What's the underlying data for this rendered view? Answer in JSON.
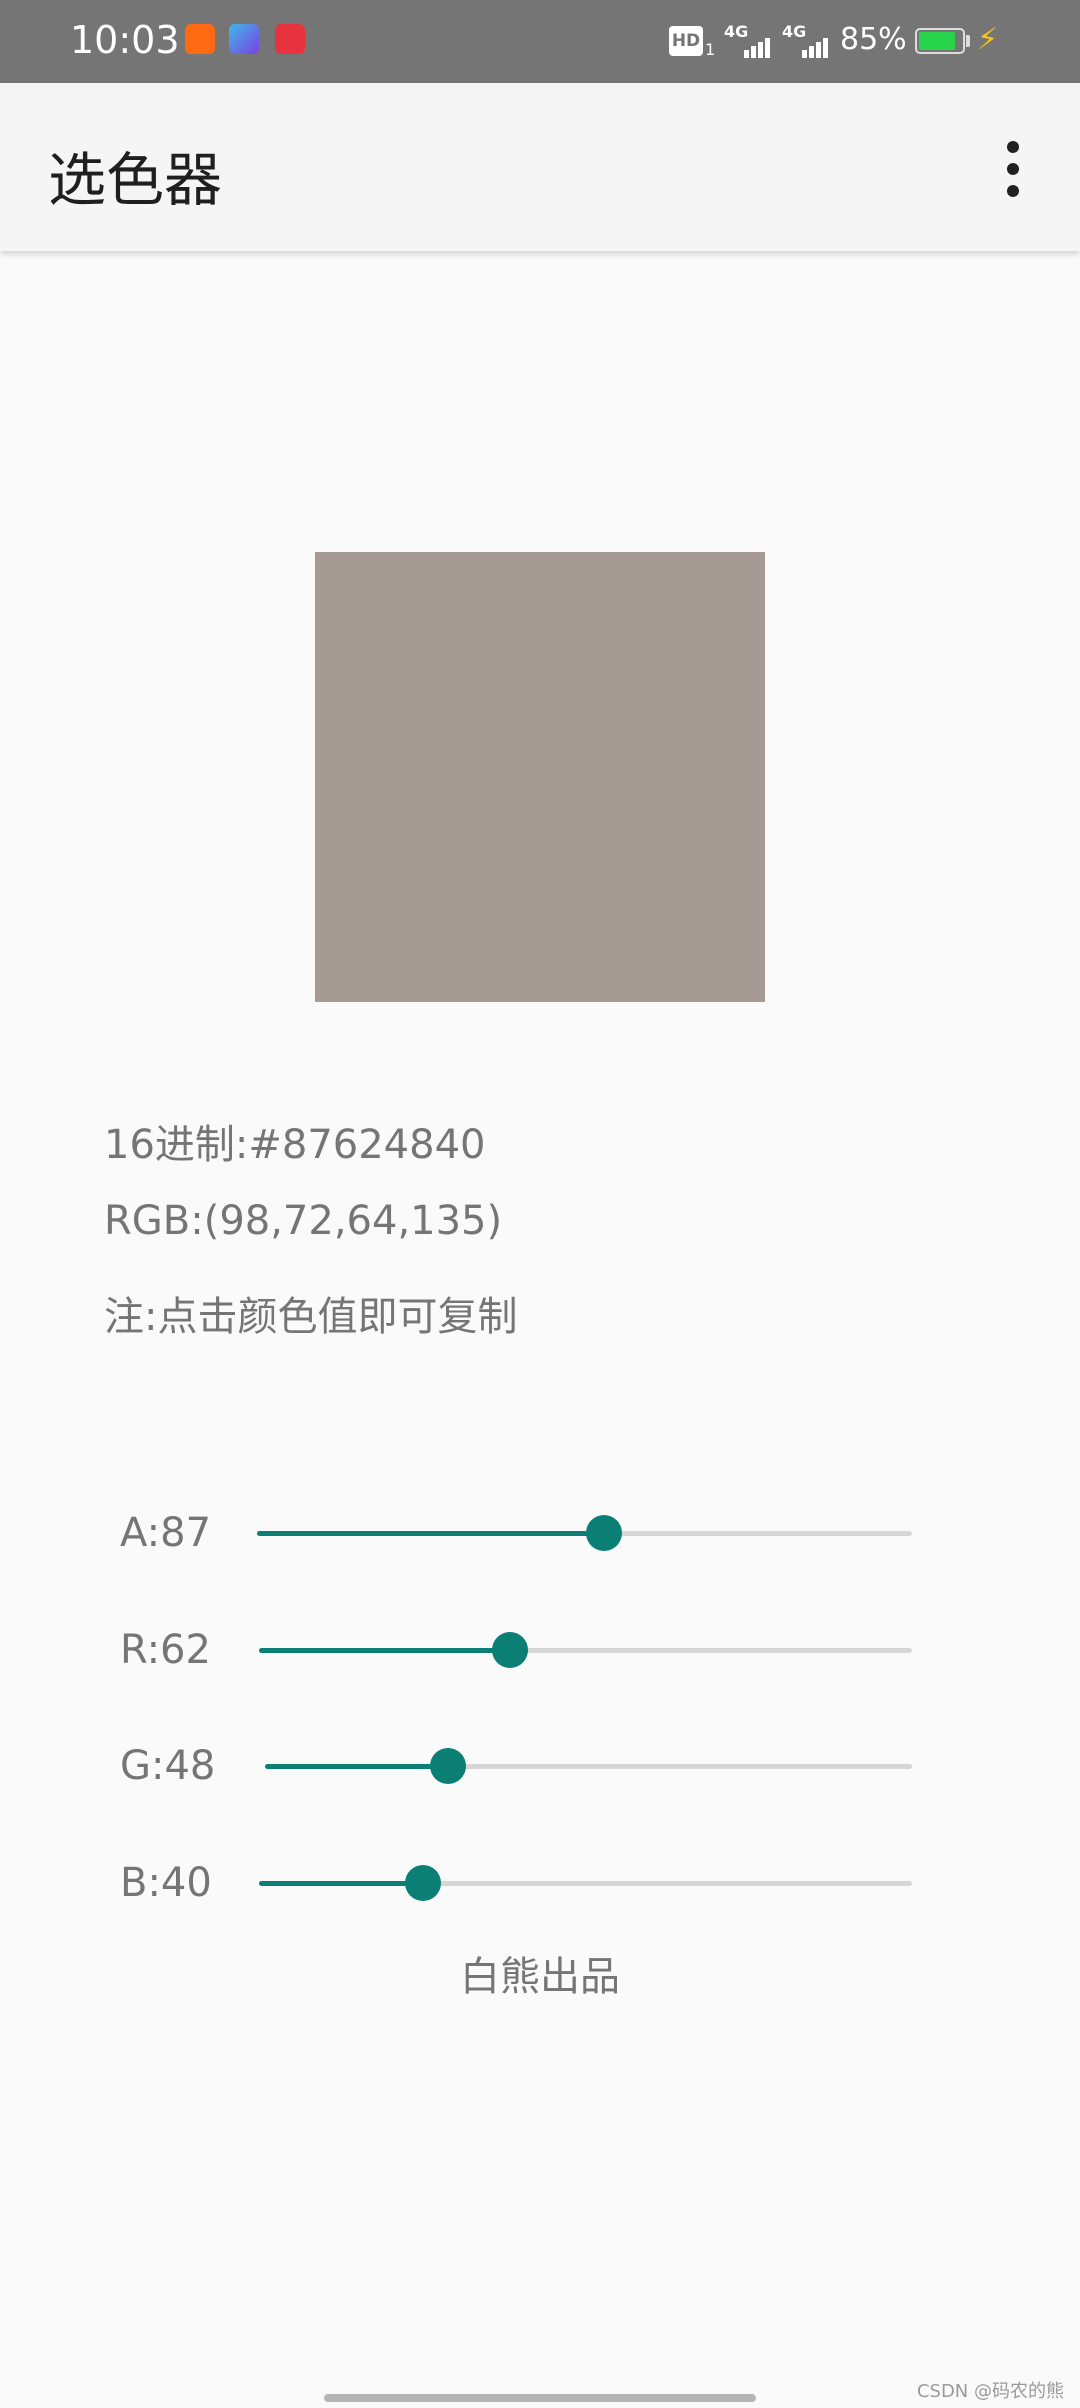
{
  "status_bar": {
    "time": "10:03",
    "hd_label": "HD",
    "hd_sub": "1",
    "network_1": "4G",
    "network_2": "4G",
    "battery_percent": "85%",
    "battery_level": 0.85,
    "notification_icons": [
      "kuaishou-icon",
      "canva-icon",
      "red-app-icon"
    ]
  },
  "app_bar": {
    "title": "选色器",
    "menu_icon": "more-vertical-icon"
  },
  "swatch": {
    "color": "#a69a95"
  },
  "info": {
    "hex": "16进制:#87624840",
    "rgb": "RGB:(98,72,64,135)",
    "note": "注:点击颜色值即可复制"
  },
  "sliders": [
    {
      "label": "A:87",
      "value": 135,
      "max": 255
    },
    {
      "label": "R:62",
      "value": 98,
      "max": 255
    },
    {
      "label": "G:48",
      "value": 72,
      "max": 255
    },
    {
      "label": "B:40",
      "value": 64,
      "max": 255
    }
  ],
  "accent_color": "#0b7f73",
  "credit": "白熊出品",
  "watermark": "CSDN @码农的熊"
}
